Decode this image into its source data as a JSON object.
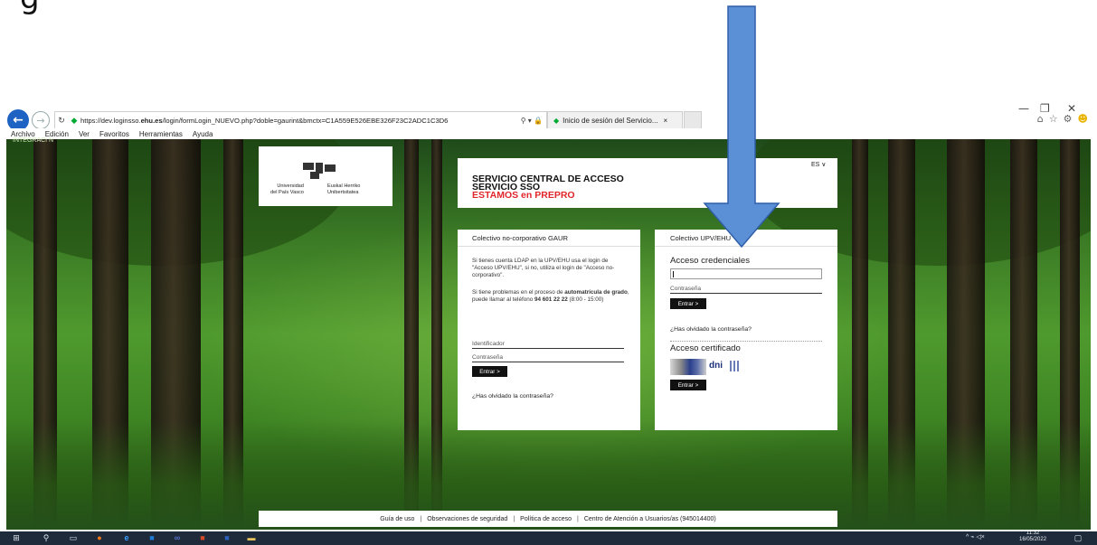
{
  "top_glyph": "g",
  "browser": {
    "url_prefix": "https://dev.loginsso.",
    "url_domain": "ehu.es",
    "url_rest": "/login/formLogin_NUEVO.php?doble=gaurint&bmctx=C1A559E526EBE326F23C2ADC1C3D6",
    "tab_title": "Inicio de sesión del Servicio...",
    "tab_close": "×",
    "address_tools": "⚲ ▾ 🔒",
    "win_minimize": "—",
    "win_restore": "❐",
    "win_close": "✕",
    "menu": [
      "Archivo",
      "Edición",
      "Ver",
      "Favoritos",
      "Herramientas",
      "Ayuda"
    ]
  },
  "page": {
    "watermark_text": "INTEGRACI N",
    "logo": {
      "left_line1": "Universidad",
      "left_line2": "del País Vasco",
      "right_line1": "Euskal Herriko",
      "right_line2": "Unibertsitatea"
    },
    "language": "ES ∨",
    "title": {
      "line1": "SERVICIO CENTRAL DE ACCESO",
      "line2": "SERVICIO SSO",
      "line3": "ESTAMOS en PREPRO"
    },
    "left_panel": {
      "heading": "Colectivo no-corporativo GAUR",
      "para1": "Si tienes cuenta LDAP en la UPV/EHU usa el login de \"Acceso UPV/EHU\", si no, utiliza el login de \"Acceso no-corporativo\".",
      "para2_a": "Si tiene problemas en el proceso de ",
      "para2_b": "automatrícula de grado",
      "para2_c": ", puede llamar al teléfono ",
      "para2_phone": "94 601 22 22",
      "para2_d": " (8:00 - 15:00)",
      "id_label": "Identificador",
      "pass_label": "Contraseña",
      "button": "Entrar >",
      "forgot": "¿Has olvidado la contraseña?"
    },
    "right_panel": {
      "heading": "Colectivo UPV/EHU",
      "cred_heading": "Acceso credenciales",
      "pass_label": "Contraseña",
      "button": "Entrar >",
      "forgot": "¿Has olvidado la contraseña?",
      "cert_heading": "Acceso certificado",
      "dni_label": "dni",
      "cert_button": "Entrar >"
    },
    "footer": [
      "Guía de uso",
      "Observaciones de seguridad",
      "Política de acceso",
      "Centro de Atención a Usuarios/as (945014400)"
    ]
  },
  "taskbar": {
    "time": "11:32",
    "date": "16/05/2022"
  },
  "colors": {
    "accent_blue": "#1e63c3",
    "arrow_blue": "#5b8fd6",
    "title_red": "#e0262b",
    "taskbar": "#1f2a3a"
  }
}
